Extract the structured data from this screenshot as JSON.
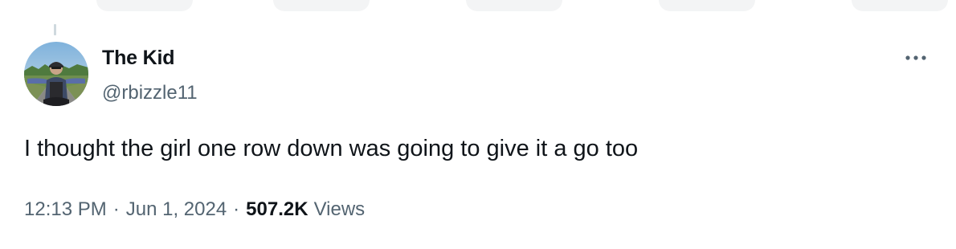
{
  "author": {
    "display_name": "The Kid",
    "handle": "@rbizzle11"
  },
  "tweet": {
    "text": "I thought the girl one row down was going to give it a go too",
    "time": "12:13 PM",
    "date": "Jun 1, 2024",
    "views_count": "507.2K",
    "views_label": "Views"
  },
  "icons": {
    "more": "more-options-icon",
    "avatar": "profile-photo"
  },
  "colors": {
    "text_primary": "#0f1419",
    "text_secondary": "#536471",
    "thread_line": "#cfd9de"
  }
}
